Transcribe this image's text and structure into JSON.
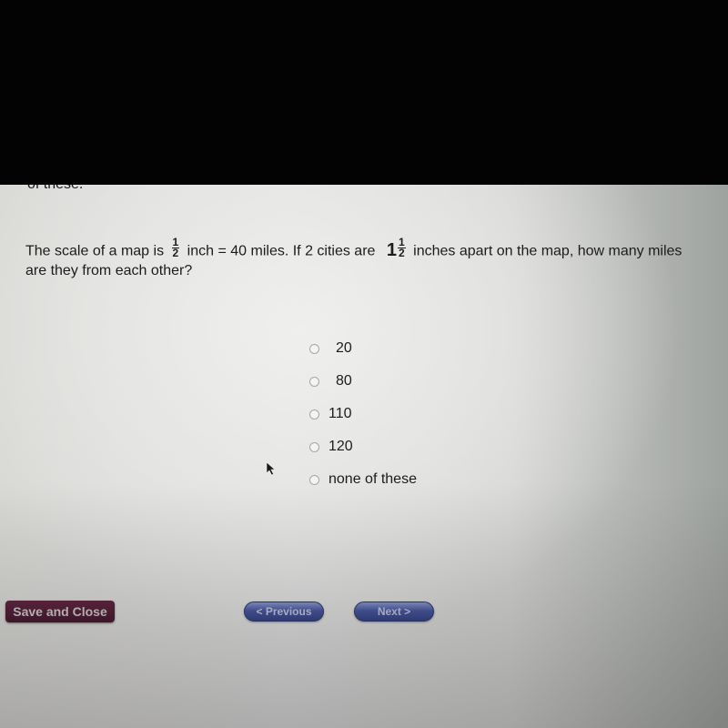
{
  "page": {
    "partial_top_text": "of these.",
    "question": {
      "part1": "The scale of a map is",
      "fraction1": {
        "numerator": "1",
        "denominator": "2"
      },
      "part2": "inch = 40 miles. If 2 cities are",
      "mixed_whole": "1",
      "fraction2": {
        "numerator": "1",
        "denominator": "2"
      },
      "part3": "inches apart on the map, how many miles are they from each other?"
    },
    "options": [
      {
        "label": "20",
        "selected": false
      },
      {
        "label": "80",
        "selected": false
      },
      {
        "label": "110",
        "selected": false
      },
      {
        "label": "120",
        "selected": false
      },
      {
        "label": "none of these",
        "selected": false
      }
    ],
    "buttons": {
      "save_close": "Save and Close",
      "previous": "< Previous",
      "next": "Next >"
    },
    "colors": {
      "save_button": "#4a1530",
      "nav_button": "#3a4890"
    }
  }
}
